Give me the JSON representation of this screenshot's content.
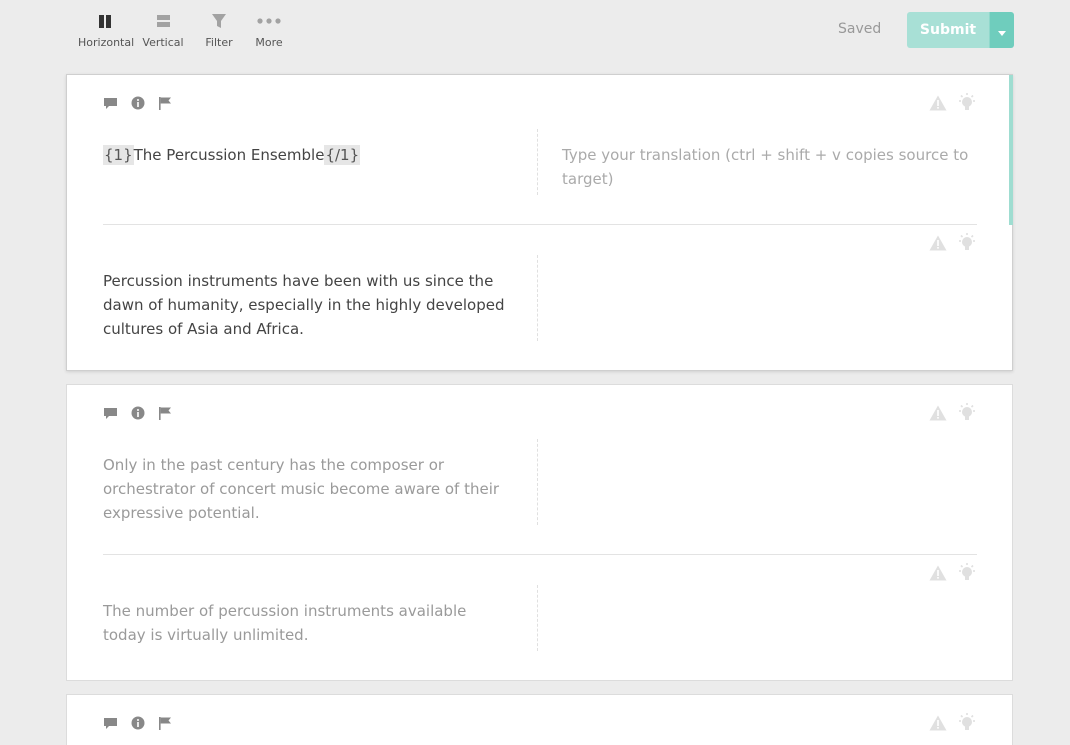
{
  "toolbar": {
    "horizontal": "Horizontal",
    "vertical": "Vertical",
    "filter": "Filter",
    "more": "More",
    "saved": "Saved",
    "submit": "Submit"
  },
  "cards": [
    {
      "segments": [
        {
          "tag_open": "{1}",
          "source": "The Percussion Ensemble",
          "tag_close": "{/1}",
          "target_placeholder": "Type your translation (ctrl + shift + v copies source to target)"
        },
        {
          "source": "Percussion instruments have been with us since the dawn of humanity, especially in the highly developed cultures of Asia and Africa."
        }
      ]
    },
    {
      "segments": [
        {
          "source": "Only in the past century has the composer or orchestrator of concert music become aware of their expressive potential."
        },
        {
          "source": "The number of percussion instruments available today is virtually unlimited."
        }
      ]
    }
  ],
  "colors": {
    "accent": "#6fcdbd",
    "accent_light": "#a8e0d6",
    "active_bar": "#9fddd1"
  }
}
